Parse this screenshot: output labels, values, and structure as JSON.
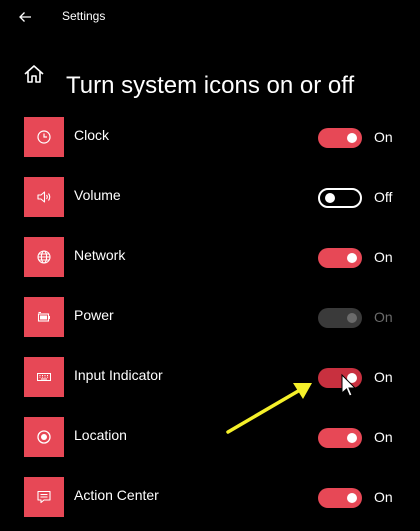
{
  "window": {
    "title": "Settings"
  },
  "page": {
    "title": "Turn system icons on or off"
  },
  "colors": {
    "accent": "#e74856",
    "annotation_arrow": "#f5f02a"
  },
  "items": [
    {
      "label": "Clock",
      "icon": "clock-icon",
      "state": "On",
      "toggle": "on"
    },
    {
      "label": "Volume",
      "icon": "speaker-icon",
      "state": "Off",
      "toggle": "off"
    },
    {
      "label": "Network",
      "icon": "globe-icon",
      "state": "On",
      "toggle": "on"
    },
    {
      "label": "Power",
      "icon": "battery-icon",
      "state": "On",
      "toggle": "disabled"
    },
    {
      "label": "Input Indicator",
      "icon": "keyboard-icon",
      "state": "On",
      "toggle": "on"
    },
    {
      "label": "Location",
      "icon": "location-icon",
      "state": "On",
      "toggle": "on"
    },
    {
      "label": "Action Center",
      "icon": "message-icon",
      "state": "On",
      "toggle": "on"
    }
  ]
}
